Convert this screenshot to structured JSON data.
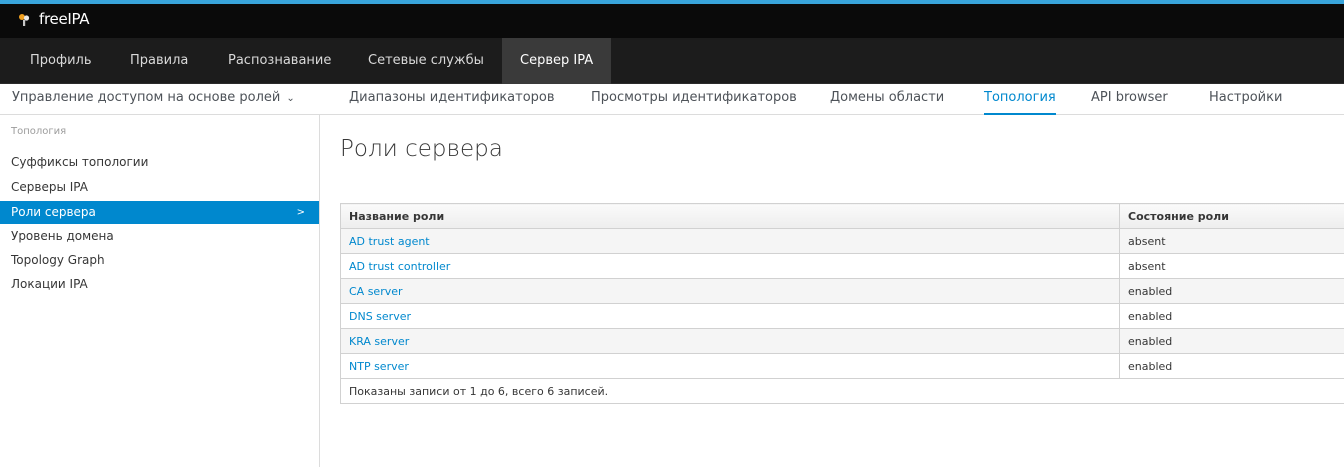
{
  "brand": {
    "name": "freeIPA"
  },
  "nav": {
    "items": [
      "Профиль",
      "Правила",
      "Распознавание",
      "Сетевые службы",
      "Сервер IPA"
    ],
    "active": "Сервер IPA"
  },
  "subnav": {
    "items": [
      "Управление доступом на основе ролей",
      "Диапазоны идентификаторов",
      "Просмотры идентификаторов",
      "Домены области",
      "Топология",
      "API browser",
      "Настройки"
    ],
    "active": "Топология"
  },
  "sidebar": {
    "heading": "Топология",
    "items": [
      "Суффиксы топологии",
      "Серверы IPA",
      "Роли сервера",
      "Уровень домена",
      "Topology Graph",
      "Локации IPA"
    ],
    "active": "Роли сервера"
  },
  "main": {
    "title": "Роли сервера",
    "table": {
      "columns": [
        "Название роли",
        "Состояние роли"
      ],
      "rows": [
        {
          "name": "AD trust agent",
          "status": "absent"
        },
        {
          "name": "AD trust controller",
          "status": "absent"
        },
        {
          "name": "CA server",
          "status": "enabled"
        },
        {
          "name": "DNS server",
          "status": "enabled"
        },
        {
          "name": "KRA server",
          "status": "enabled"
        },
        {
          "name": "NTP server",
          "status": "enabled"
        }
      ],
      "footer": "Показаны записи от 1 до 6, всего 6 записей."
    }
  },
  "colors": {
    "accent": "#0088ce",
    "top_stripe": "#39a5dc",
    "brand_bg": "#0a0a0a",
    "nav_bg": "#1c1c1c"
  }
}
